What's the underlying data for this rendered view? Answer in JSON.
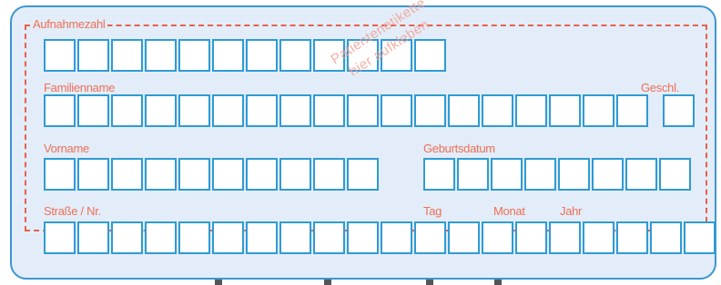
{
  "form": {
    "aufnahmezahl_label": "Aufnahmezahl",
    "familienname_label": "Familienname",
    "geschl_label": "Geschl.",
    "vorname_label": "Vorname",
    "geburtsdatum_label": "Geburtsdatum",
    "strasse_label": "Straße / Nr.",
    "tag_label": "Tag",
    "monat_label": "Monat",
    "jahr_label": "Jahr",
    "stamp_line1": "Patientenetikette",
    "stamp_line2": "hier aufkleben"
  },
  "colors": {
    "panel_bg": "#e3edf9",
    "box_border": "#2f9bd4",
    "label_red": "#ef6f55"
  }
}
